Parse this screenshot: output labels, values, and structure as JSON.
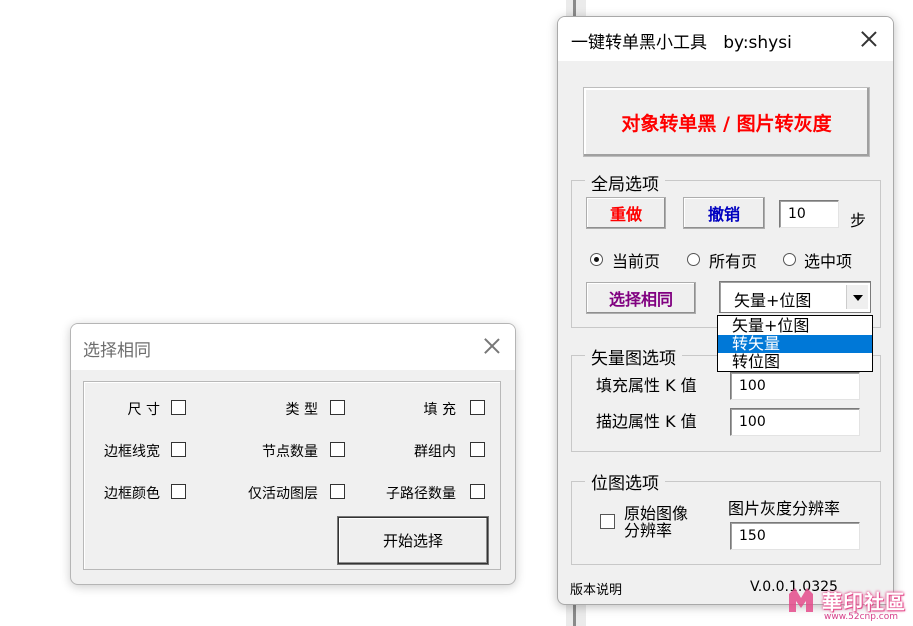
{
  "main_window": {
    "title": "一键转单黑小工具   by:shysi",
    "big_button": "对象转单黑 / 图片转灰度",
    "global": {
      "label": "全局选项",
      "redo": "重做",
      "undo": "撤销",
      "steps_value": "10",
      "steps_unit": "步",
      "radios": [
        {
          "label": "当前页",
          "checked": true
        },
        {
          "label": "所有页",
          "checked": false
        },
        {
          "label": "选中项",
          "checked": false
        }
      ],
      "select_same": "选择相同",
      "combo_value": "矢量+位图",
      "dropdown_options": [
        "矢量+位图",
        "转矢量",
        "转位图"
      ],
      "dropdown_selected": "转矢量"
    },
    "vector": {
      "label": "矢量图选项",
      "fill_label": "填充属性 K 值",
      "fill_value": "100",
      "stroke_label": "描边属性 K 值",
      "stroke_value": "100"
    },
    "bitmap": {
      "label": "位图选项",
      "original_label_1": "原始图像",
      "original_label_2": "分辨率",
      "resolution_label": "图片灰度分辨率",
      "resolution_value": "150"
    },
    "footer": {
      "version_notes": "版本说明",
      "version": "V.0.0.1.0325"
    }
  },
  "select_same_window": {
    "title": "选择相同",
    "options": [
      "尺 寸",
      "类 型",
      "填 充",
      "边框线宽",
      "节点数量",
      "群组内",
      "边框颜色",
      "仅活动图层",
      "子路径数量"
    ],
    "start_button": "开始选择"
  },
  "watermark": {
    "text": "華印社區",
    "url": "www.52cnp.com"
  },
  "colors": {
    "big_button_text": "#ff0000",
    "redo_text": "#ff0000",
    "undo_text": "#0000c0",
    "select_same_text": "#800080",
    "dropdown_highlight": "#0078d7"
  }
}
